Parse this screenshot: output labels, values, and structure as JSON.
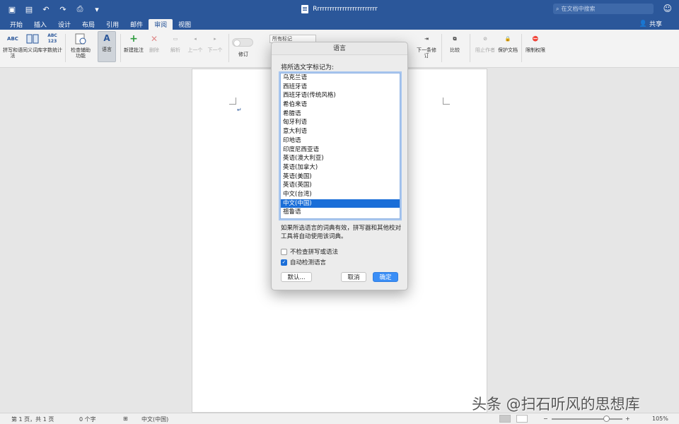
{
  "titlebar": {
    "doc_title": "Rrrrrrrrrrrrrrrrrrrrrrrrr",
    "search_placeholder": "在文档中搜索"
  },
  "tabs": [
    {
      "label": "开始"
    },
    {
      "label": "插入"
    },
    {
      "label": "设计"
    },
    {
      "label": "布局"
    },
    {
      "label": "引用"
    },
    {
      "label": "邮件"
    },
    {
      "label": "审阅"
    },
    {
      "label": "视图"
    }
  ],
  "share_label": "共享",
  "ribbon": {
    "spelling": "拼写和语法",
    "thesaurus": "同义词库",
    "wordcount": "字数统计",
    "accessibility": "检查辅助功能",
    "language": "语言",
    "new_comment": "新建批注",
    "delete": "删除",
    "resolve": "解析",
    "prev": "上一个",
    "next": "下一个",
    "track": "修订",
    "markup_select": "所有标记",
    "next_change": "下一条修订",
    "compare": "比较",
    "block_authors": "阻止作者",
    "protect": "保护文档",
    "restrict": "限制权限",
    "wordcount_icon": "ABC 123",
    "spell_icon": "ABC"
  },
  "dialog": {
    "title": "语言",
    "label": "将所选文字标记为:",
    "languages": [
      "乌克兰语",
      "西班牙语",
      "西班牙语(传统风格)",
      "希伯来语",
      "希腊语",
      "匈牙利语",
      "意大利语",
      "印地语",
      "印度尼西亚语",
      "英语(澳大利亚)",
      "英语(加拿大)",
      "英语(美国)",
      "英语(英国)",
      "中文(台湾)",
      "中文(中国)",
      "祖鲁语"
    ],
    "selected_index": 14,
    "note": "如果所选语言的词典有效，拼写器和其他校对工具将自动使用该词典。",
    "check1": "不检查拼写或语法",
    "check1_on": false,
    "check2": "自动检测语言",
    "check2_on": true,
    "default_btn": "默认...",
    "cancel_btn": "取消",
    "ok_btn": "确定"
  },
  "status": {
    "page": "第 1 页，共 1 页",
    "words": "0 个字",
    "language": "中文(中国)",
    "zoom": "105%"
  },
  "watermark": "头条 @扫石听风的思想库"
}
